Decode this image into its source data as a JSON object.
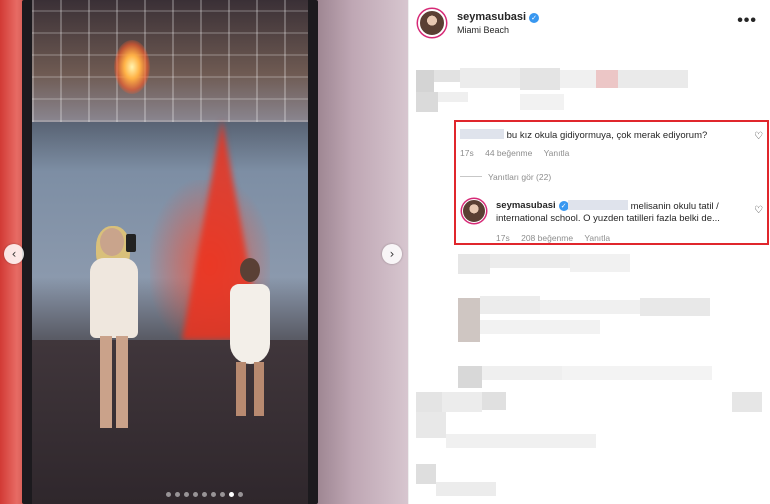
{
  "post": {
    "username": "seymasubasi",
    "location": "Miami Beach",
    "more_label": "•••",
    "carousel": {
      "prev_label": "‹",
      "next_label": "›",
      "slide_count": 9,
      "active_slide": 8
    }
  },
  "comments": {
    "main": {
      "text": "bu kız okula gidiyormuya, çok merak ediyorum?",
      "time": "17s",
      "likes": "44 beğenme",
      "reply_label": "Yanıtla"
    },
    "view_replies": "Yanıtları gör (22)",
    "reply": {
      "username": "seymasubasi",
      "text_line1": "melisanin okulu tatil /",
      "text_line2": "international school. O yuzden tatilleri fazla belki de...",
      "time": "17s",
      "likes": "208 beğenme",
      "reply_label": "Yanıtla"
    }
  },
  "icons": {
    "heart": "♡",
    "verified": "✓"
  },
  "colors": {
    "highlight": "#e0262c",
    "verified": "#3897f0",
    "muted": "#8e8e8e"
  }
}
